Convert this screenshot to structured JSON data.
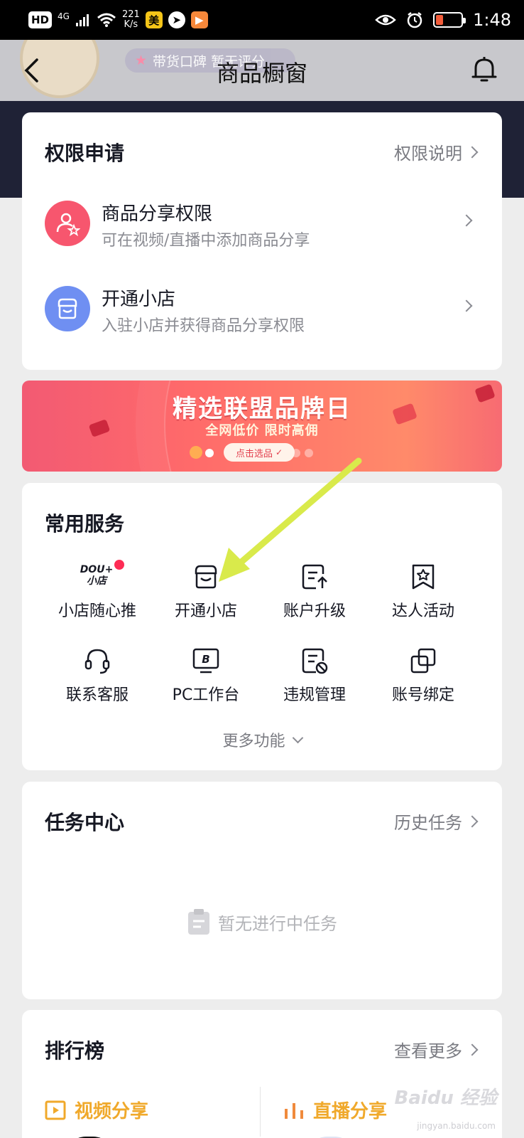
{
  "status_bar": {
    "hd": "HD",
    "network": "4G",
    "speed_value": "221",
    "speed_unit": "K/s",
    "app_badge": "美",
    "time": "1:48"
  },
  "header": {
    "tag_text": "带货口碑 暂无评分",
    "title": "商品橱窗"
  },
  "permissions": {
    "title": "权限申请",
    "link": "权限说明",
    "items": [
      {
        "title": "商品分享权限",
        "desc": "可在视频/直播中添加商品分享",
        "icon": "user-star-icon",
        "color": "#f7566e"
      },
      {
        "title": "开通小店",
        "desc": "入驻小店并获得商品分享权限",
        "icon": "store-icon",
        "color": "#6f8ff2"
      }
    ]
  },
  "banner": {
    "title": "精选联盟品牌日",
    "subtitle": "全网低价 限时高佣",
    "button": "点击选品",
    "active_slide": 1,
    "slide_count": 5
  },
  "services": {
    "title": "常用服务",
    "items": [
      {
        "label": "小店随心推",
        "icon": "dou-plus-store-icon",
        "logo_top": "DOU+",
        "logo_bottom": "小店"
      },
      {
        "label": "开通小店",
        "icon": "store-icon"
      },
      {
        "label": "账户升级",
        "icon": "account-upgrade-icon"
      },
      {
        "label": "达人活动",
        "icon": "badge-star-icon"
      },
      {
        "label": "联系客服",
        "icon": "headset-icon"
      },
      {
        "label": "PC工作台",
        "icon": "monitor-b-icon"
      },
      {
        "label": "违规管理",
        "icon": "violation-doc-icon"
      },
      {
        "label": "账号绑定",
        "icon": "link-copy-icon"
      }
    ],
    "more": "更多功能"
  },
  "tasks": {
    "title": "任务中心",
    "link": "历史任务",
    "empty_text": "暂无进行中任务"
  },
  "ranking": {
    "title": "排行榜",
    "link": "查看更多",
    "tabs": [
      {
        "label": "视频分享",
        "icon": "video-play-icon"
      },
      {
        "label": "直播分享",
        "icon": "live-bars-icon"
      }
    ]
  },
  "colors": {
    "accent_red": "#fe2c55",
    "arrow": "#d9ea4b",
    "rank_tab": "#f0a92b"
  },
  "watermark": {
    "main": "Baidu 经验",
    "sub": "jingyan.baidu.com"
  }
}
